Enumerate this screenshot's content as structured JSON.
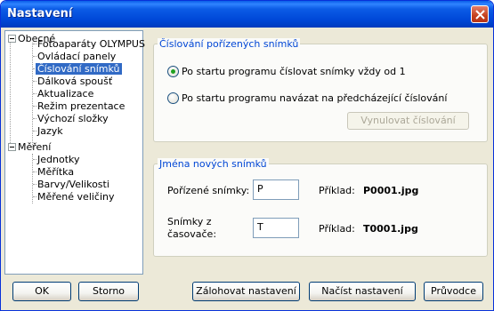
{
  "window": {
    "title": "Nastavení"
  },
  "tree": {
    "items": [
      {
        "label": "Obecné",
        "level": 0,
        "expanded": true
      },
      {
        "label": "Fotoaparáty OLYMPUS",
        "level": 1
      },
      {
        "label": "Ovládací panely",
        "level": 1
      },
      {
        "label": "Číslování snímků",
        "level": 1,
        "selected": true
      },
      {
        "label": "Dálková spoušť",
        "level": 1
      },
      {
        "label": "Aktualizace",
        "level": 1
      },
      {
        "label": "Režim prezentace",
        "level": 1
      },
      {
        "label": "Výchozí složky",
        "level": 1
      },
      {
        "label": "Jazyk",
        "level": 1
      },
      {
        "label": "Měření",
        "level": 0,
        "expanded": true
      },
      {
        "label": "Jednotky",
        "level": 1
      },
      {
        "label": "Měřítka",
        "level": 1
      },
      {
        "label": "Barvy/Velikosti",
        "level": 1
      },
      {
        "label": "Měřené veličiny",
        "level": 1
      }
    ]
  },
  "numbering": {
    "title": "Číslování pořízených snímků",
    "option1": "Po startu programu číslovat snímky vždy od 1",
    "option2": "Po startu programu navázat na předcházející číslování",
    "selected_option": 1,
    "reset_button": "Vynulovat číslování"
  },
  "names": {
    "title": "Jména nových snímků",
    "captured_label": "Pořízené snímky:",
    "captured_value": "P",
    "example_label1": "Příklad:",
    "example_value1": "P0001.jpg",
    "timer_label_line1": "Snímky z",
    "timer_label_line2": "časovače:",
    "timer_value": "T",
    "example_label2": "Příklad:",
    "example_value2": "T0001.jpg"
  },
  "buttons": {
    "ok": "OK",
    "cancel": "Storno",
    "backup": "Zálohovat nastavení",
    "load": "Načíst nastavení",
    "guide": "Průvodce"
  }
}
